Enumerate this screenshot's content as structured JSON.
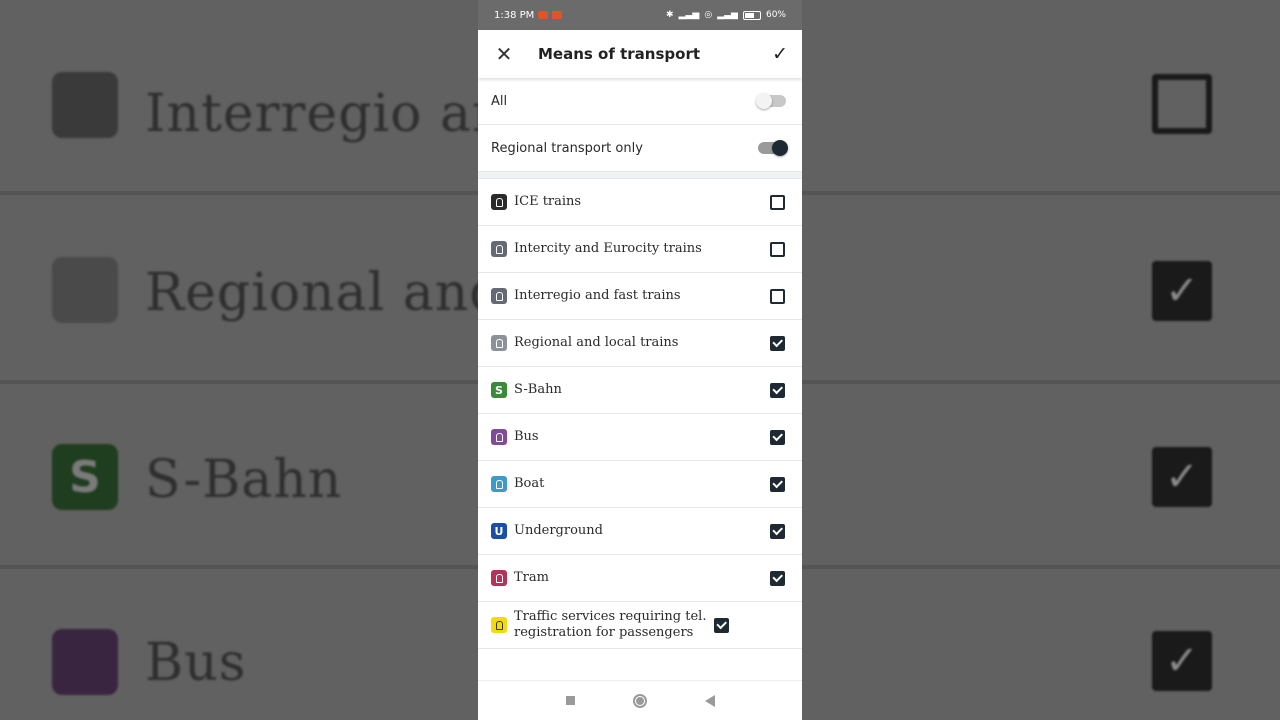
{
  "background": {
    "rows": [
      {
        "text": "Interregio and",
        "icon": "",
        "checked": false,
        "color": "#3a3a3a"
      },
      {
        "text": "Regional and ",
        "icon": "",
        "checked": true,
        "color": "#4a4a4a"
      },
      {
        "text": "S-Bahn",
        "icon": "S",
        "checked": true,
        "color": "#1f3d1f"
      },
      {
        "text": "Bus",
        "icon": "",
        "checked": true,
        "color": "#3a2540"
      }
    ]
  },
  "status": {
    "time": "1:38 PM",
    "battery": "60%"
  },
  "appbar": {
    "title": "Means of transport",
    "close_icon": "close-icon",
    "done_icon": "check-icon"
  },
  "toggles": [
    {
      "label": "All",
      "on": false
    },
    {
      "label": "Regional transport only",
      "on": true
    }
  ],
  "items": [
    {
      "label": "ICE trains",
      "checked": false,
      "color": "#2a2a2a",
      "glyph": "",
      "icon": "ice-train-icon"
    },
    {
      "label": "Intercity and Eurocity trains",
      "checked": false,
      "color": "#646973",
      "glyph": "",
      "icon": "intercity-train-icon"
    },
    {
      "label": "Interregio and fast trains",
      "checked": false,
      "color": "#646973",
      "glyph": "",
      "icon": "interregio-train-icon"
    },
    {
      "label": "Regional and local trains",
      "checked": true,
      "color": "#8c9098",
      "glyph": "",
      "icon": "regional-train-icon"
    },
    {
      "label": "S-Bahn",
      "checked": true,
      "color": "#3a8a3a",
      "glyph": "S",
      "icon": "s-bahn-icon"
    },
    {
      "label": "Bus",
      "checked": true,
      "color": "#814a9a",
      "glyph": "",
      "icon": "bus-icon"
    },
    {
      "label": "Boat",
      "checked": true,
      "color": "#3d9cc7",
      "glyph": "",
      "icon": "boat-icon"
    },
    {
      "label": "Underground",
      "checked": true,
      "color": "#1b4fa3",
      "glyph": "U",
      "icon": "underground-icon"
    },
    {
      "label": "Tram",
      "checked": true,
      "color": "#b3335a",
      "glyph": "",
      "icon": "tram-icon"
    },
    {
      "label": "Traffic services requiring tel. registration for passengers",
      "checked": true,
      "color": "#f5d90a",
      "glyph": "",
      "icon": "taxi-icon"
    }
  ]
}
